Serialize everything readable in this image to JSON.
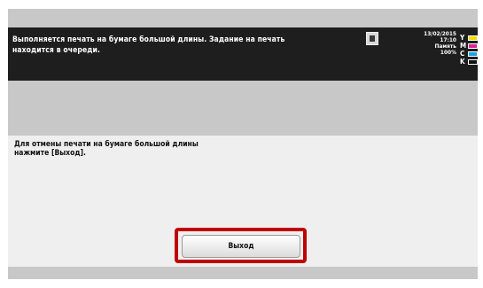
{
  "status": {
    "message_line1": "Выполняется печать на бумаге большой длины. Задание на печать",
    "message_line2": "находится в очереди.",
    "job_icon": "printer-job-icon",
    "date": "13/02/2015",
    "time": "17:10",
    "memory_label": "Память",
    "memory_value": "100%"
  },
  "toner": [
    {
      "letter": "Y",
      "color": "#f4d800"
    },
    {
      "letter": "M",
      "color": "#e0208c"
    },
    {
      "letter": "C",
      "color": "#1ea0e6"
    },
    {
      "letter": "K",
      "color": "#111111"
    }
  ],
  "panel": {
    "message_line1": "Для отмены печати на бумаге большой длины",
    "message_line2": "нажмите [Выход]."
  },
  "buttons": {
    "exit_label": "Выход"
  },
  "colors": {
    "highlight": "#c00000",
    "status_bg": "#1e1e1e"
  }
}
